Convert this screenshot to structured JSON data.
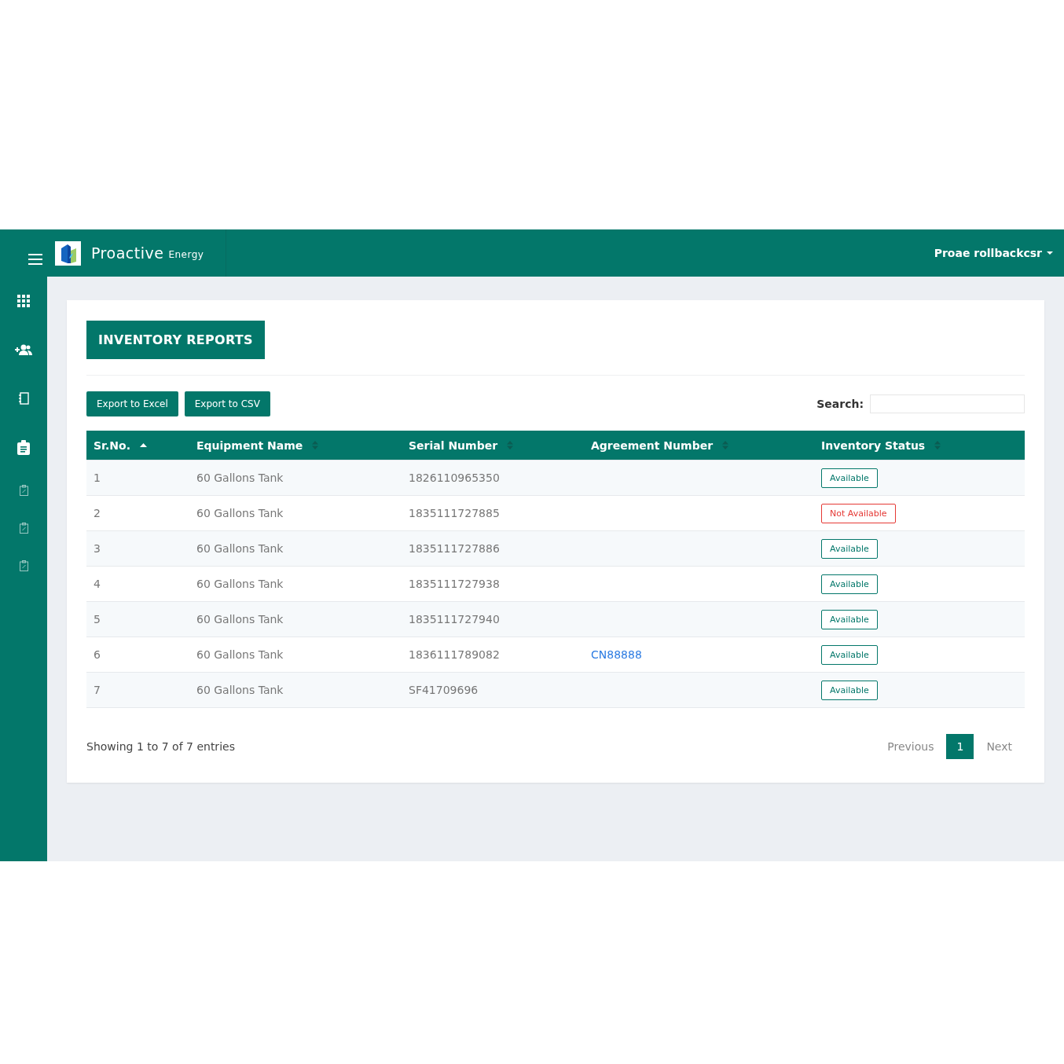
{
  "header": {
    "brand": "Proactive",
    "brand_suffix": "Energy",
    "user": "Proae rollbackcsr"
  },
  "sidebar": {
    "items": [
      {
        "kind": "grid"
      },
      {
        "kind": "people"
      },
      {
        "kind": "notebook"
      },
      {
        "kind": "clipboard"
      },
      {
        "kind": "clipboard_small"
      },
      {
        "kind": "clipboard_small"
      },
      {
        "kind": "clipboard_small"
      }
    ]
  },
  "page": {
    "title": "INVENTORY REPORTS"
  },
  "export_buttons": [
    "Export to Excel",
    "Export to CSV"
  ],
  "search": {
    "label": "Search:"
  },
  "table": {
    "columns": [
      {
        "label": "Sr.No.",
        "sorted": true
      },
      {
        "label": "Equipment Name",
        "sorted": false
      },
      {
        "label": "Serial Number",
        "sorted": false
      },
      {
        "label": "Agreement Number",
        "sorted": false
      },
      {
        "label": "Inventory Status",
        "sorted": false
      }
    ],
    "rows": [
      {
        "sr": "1",
        "equipment": "60 Gallons Tank",
        "serial": "1826110965350",
        "status": {
          "label": "Available",
          "kind": "available"
        }
      },
      {
        "sr": "2",
        "equipment": "60 Gallons Tank",
        "serial": "1835111727885",
        "status": {
          "label": "Not Available",
          "kind": "not_available"
        }
      },
      {
        "sr": "3",
        "equipment": "60 Gallons Tank",
        "serial": "1835111727886",
        "status": {
          "label": "Available",
          "kind": "available"
        }
      },
      {
        "sr": "4",
        "equipment": "60 Gallons Tank",
        "serial": "1835111727938",
        "status": {
          "label": "Available",
          "kind": "available"
        }
      },
      {
        "sr": "5",
        "equipment": "60 Gallons Tank",
        "serial": "1835111727940",
        "status": {
          "label": "Available",
          "kind": "available"
        }
      },
      {
        "sr": "6",
        "equipment": "60 Gallons Tank",
        "serial": "1836111789082",
        "agreement": "CN88888",
        "status": {
          "label": "Available",
          "kind": "available"
        }
      },
      {
        "sr": "7",
        "equipment": "60 Gallons Tank",
        "serial": "SF41709696",
        "status": {
          "label": "Available",
          "kind": "available"
        }
      }
    ]
  },
  "footer": {
    "info": "Showing 1 to 7 of 7 entries",
    "previous": "Previous",
    "pages": [
      {
        "label": "1",
        "selected": true
      }
    ],
    "next": "Next"
  }
}
